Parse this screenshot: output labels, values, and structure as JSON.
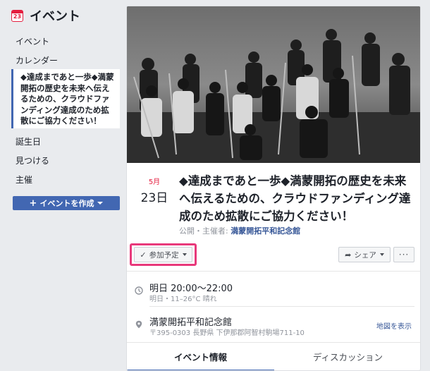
{
  "sidebar": {
    "icon_number": "23",
    "title": "イベント",
    "items": [
      {
        "label": "イベント"
      },
      {
        "label": "カレンダー"
      }
    ],
    "active_item": "◆達成まであと一歩◆満蒙開拓の歴史を未来へ伝えるための、クラウドファンディング達成のため拡散にご協力ください！",
    "items_after": [
      {
        "label": "誕生日"
      },
      {
        "label": "見つける"
      },
      {
        "label": "主催"
      }
    ],
    "create_button": "イベントを作成",
    "accent_color": "#4267b2"
  },
  "event": {
    "month": "5月",
    "day": "23日",
    "title": "◆達成まであと一歩◆満蒙開拓の歴史を未来へ伝えるための、クラウドファンディング達成のため拡散にご協力ください！",
    "host_prefix": "公開・主催者: ",
    "host_name": "満蒙開拓平和記念館",
    "going_label": "参加予定",
    "share_label": "シェア",
    "more_label": "···",
    "time_main": "明日 20:00〜22:00",
    "time_sub": "明日・11–26°C 晴れ",
    "place_name": "満蒙開拓平和記念館",
    "place_address": "〒395-0303 長野県 下伊那郡阿智村駒場711-10",
    "map_link": "地図を表示",
    "highlight_color": "#e8397b"
  },
  "tabs": [
    {
      "label": "イベント情報"
    },
    {
      "label": "ディスカッション"
    }
  ]
}
